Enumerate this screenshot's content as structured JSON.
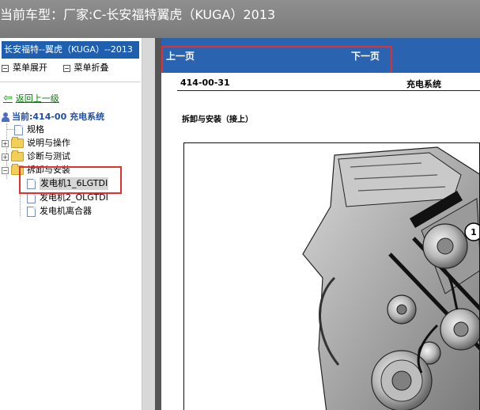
{
  "window": {
    "title": "当前车型：厂家:C-长安福特翼虎（KUGA）2013"
  },
  "sidebar": {
    "header": "长安福特--翼虎（KUGA）--2013",
    "expand_label": "菜单展开",
    "collapse_label": "菜单折叠",
    "back_label": "返回上一级",
    "current_label": "当前:414-00 充电系统",
    "tree": {
      "spec": "规格",
      "desc_ops": "说明与操作",
      "diag_test": "诊断与测试",
      "removal_install": "拆卸与安装",
      "gen1": "发电机1_6LGTDI",
      "gen2": "发电机2_OLGTDI",
      "clutch": "发电机离合器"
    }
  },
  "nav": {
    "prev": "上一页",
    "next": "下一页"
  },
  "document": {
    "number": "414-00-31",
    "title": "充电系统",
    "heading": "拆卸与安装（接上）",
    "callout": "1"
  },
  "colors": {
    "accent_blue": "#2a63b0",
    "sidebar_header": "#1f5fb0",
    "highlight": "#e03030",
    "link_green": "#0a7a0a"
  }
}
